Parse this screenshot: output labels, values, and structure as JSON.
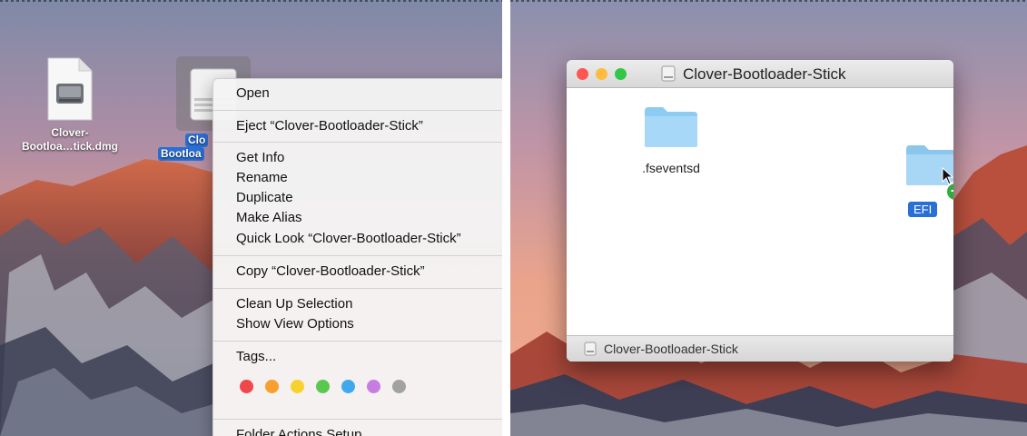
{
  "left_screen": {
    "desktop_icons": [
      {
        "label_line1": "Clover-",
        "label_line2": "Bootloa…tick.dmg"
      },
      {
        "label_line1": "Clo",
        "label_line2": "Bootloa"
      }
    ],
    "context_menu": {
      "items": {
        "open": "Open",
        "eject": "Eject “Clover-Bootloader-Stick”",
        "get_info": "Get Info",
        "rename": "Rename",
        "duplicate": "Duplicate",
        "make_alias": "Make Alias",
        "quick_look": "Quick Look “Clover-Bootloader-Stick”",
        "copy": "Copy “Clover-Bootloader-Stick”",
        "clean_up": "Clean Up Selection",
        "show_view_options": "Show View Options",
        "tags": "Tags...",
        "folder_actions": "Folder Actions Setup"
      },
      "tag_colors": [
        "#f0474d",
        "#f7a02f",
        "#f7d22f",
        "#5ac84f",
        "#3fa9ec",
        "#c67de2",
        "#a2a2a2"
      ]
    }
  },
  "right_screen": {
    "window": {
      "title": "Clover-Bootloader-Stick",
      "status_label": "Clover-Bootloader-Stick",
      "traffic_lights": [
        "#fc5753",
        "#fdbc40",
        "#33c748"
      ],
      "folders": [
        {
          "label": ".fseventsd"
        },
        {
          "label": "EFI"
        }
      ]
    }
  },
  "colors": {
    "selection_blue": "#2a6fd6",
    "folder_blue": "#8ecbf3",
    "copy_badge_green": "#2dae3b"
  }
}
